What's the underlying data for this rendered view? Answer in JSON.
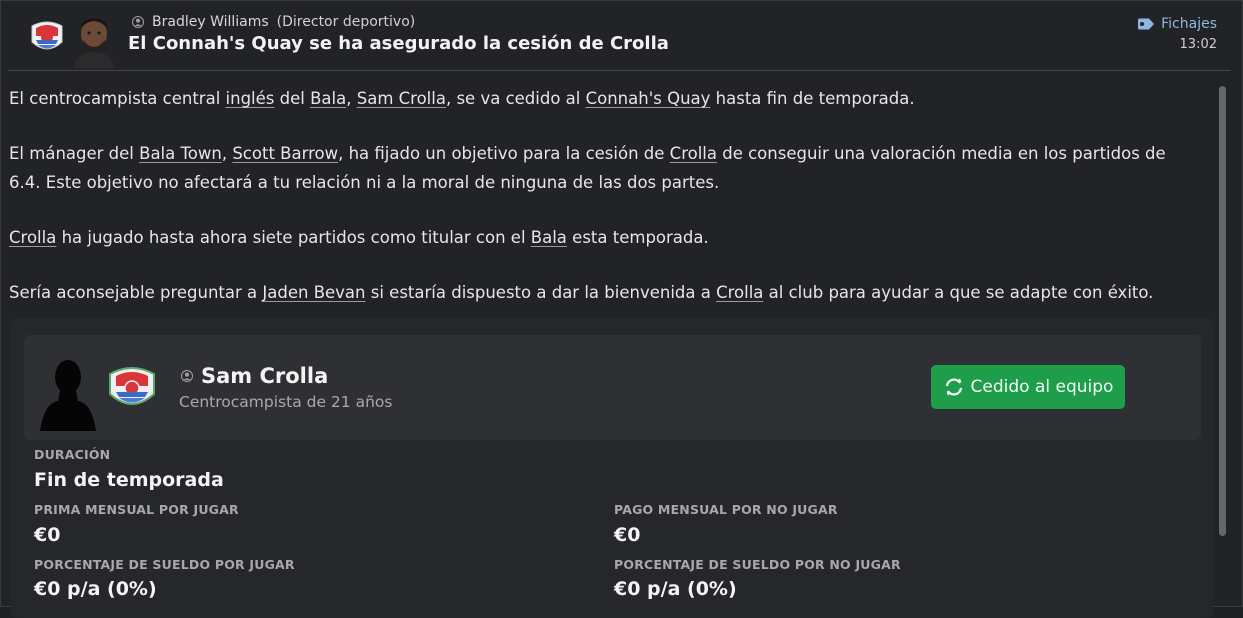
{
  "header": {
    "sender_name": "Bradley Williams",
    "sender_role": "(Director deportivo)",
    "subject": "El Connah's Quay se ha asegurado la cesión de Crolla",
    "category": "Fichajes",
    "time": "13:02"
  },
  "message": {
    "p1": {
      "a": "El centrocampista central ",
      "l1": "inglés",
      "b": " del ",
      "l2": "Bala",
      "c": ", ",
      "l3": "Sam Crolla",
      "d": ", se va cedido al ",
      "l4": "Connah's Quay",
      "e": " hasta fin de temporada."
    },
    "p2": {
      "a": "El mánager del ",
      "l1": "Bala Town",
      "b": ", ",
      "l2": "Scott Barrow",
      "c": ", ha fijado un objetivo para la cesión de ",
      "l3": "Crolla",
      "d": " de conseguir una valoración media en los partidos de 6.4. Este objetivo no afectará a tu relación ni a la moral de ninguna de las dos partes."
    },
    "p3": {
      "l1": "Crolla",
      "a": " ha jugado hasta ahora siete partidos como titular con el ",
      "l2": "Bala",
      "b": " esta temporada."
    },
    "p4": {
      "a": "Sería aconsejable preguntar a ",
      "l1": "Jaden Bevan",
      "b": " si estaría dispuesto a dar la bienvenida a ",
      "l2": "Crolla",
      "c": " al club para ayudar a que se adapte con éxito."
    }
  },
  "player": {
    "name": "Sam Crolla",
    "description": "Centrocampista de 21 años",
    "status_button": "Cedido al equipo"
  },
  "loan": {
    "duration_label": "DURACIÓN",
    "duration_value": "Fin de temporada",
    "bonus_play_label": "PRIMA MENSUAL POR JUGAR",
    "bonus_play_value": "€0",
    "fee_noplay_label": "PAGO MENSUAL POR NO JUGAR",
    "fee_noplay_value": "€0",
    "wage_play_label": "PORCENTAJE DE SUELDO POR JUGAR",
    "wage_play_value": "€0 p/a (0%)",
    "wage_noplay_label": "PORCENTAJE DE SUELDO POR NO JUGAR",
    "wage_noplay_value": "€0 p/a (0%)"
  },
  "colors": {
    "accent_green": "#1e9e4a",
    "link_blue": "#8fb6e0",
    "background": "#222326"
  },
  "icons": [
    "club-badge-icon",
    "person-icon",
    "tag-icon",
    "loan-cycle-icon"
  ]
}
